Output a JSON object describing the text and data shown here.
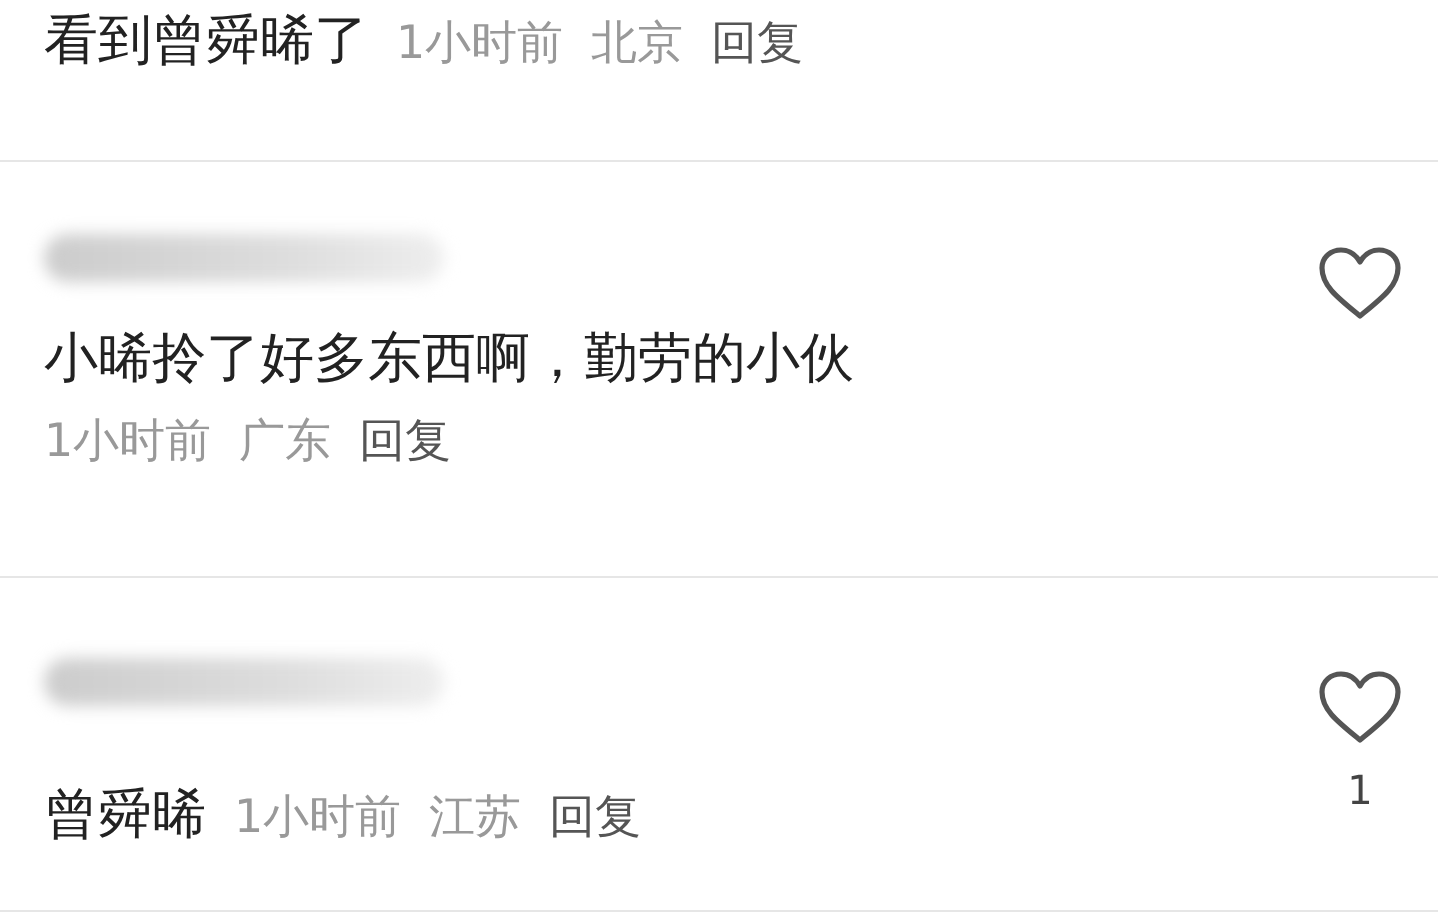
{
  "comments": [
    {
      "kind": "inline",
      "author_blurred": false,
      "heart": false,
      "text": "看到曾舜晞了",
      "time": "1小时前",
      "location": "北京",
      "reply": "回复"
    },
    {
      "kind": "block",
      "author_blurred": true,
      "heart": true,
      "text": "小晞拎了好多东西啊，勤劳的小伙",
      "time": "1小时前",
      "location": "广东",
      "reply": "回复"
    },
    {
      "kind": "inline",
      "author_blurred": true,
      "heart": true,
      "likes": "1",
      "text": "曾舜晞",
      "time": "1小时前",
      "location": "江苏",
      "reply": "回复"
    }
  ]
}
